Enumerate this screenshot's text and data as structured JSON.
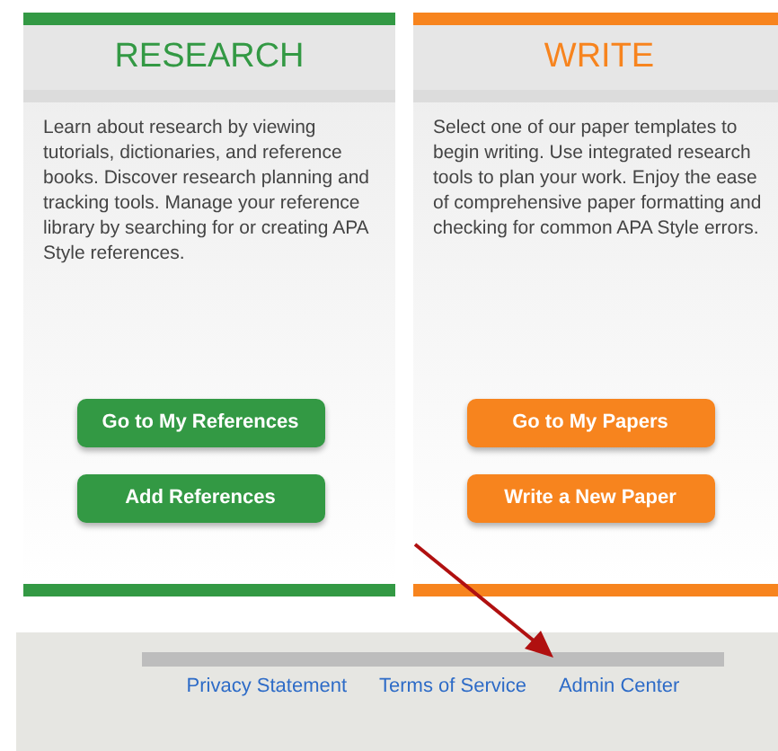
{
  "cards": [
    {
      "title": "RESEARCH",
      "color": "#339944",
      "description": "Learn about research by viewing tutorials, dictionaries, and reference books. Discover research planning and tracking tools. Manage your reference library by searching for or creating APA Style references.",
      "buttons": [
        "Go to My References",
        "Add References"
      ]
    },
    {
      "title": "WRITE",
      "color": "#f7841e",
      "description": "Select one of our paper templates to begin writing. Use integrated research tools to plan your work. Enjoy the ease of comprehensive paper formatting and checking for common APA Style errors.",
      "buttons": [
        "Go to My Papers",
        "Write a New Paper"
      ]
    }
  ],
  "footer": {
    "links": [
      "Privacy Statement",
      "Terms of Service",
      "Admin Center"
    ]
  }
}
